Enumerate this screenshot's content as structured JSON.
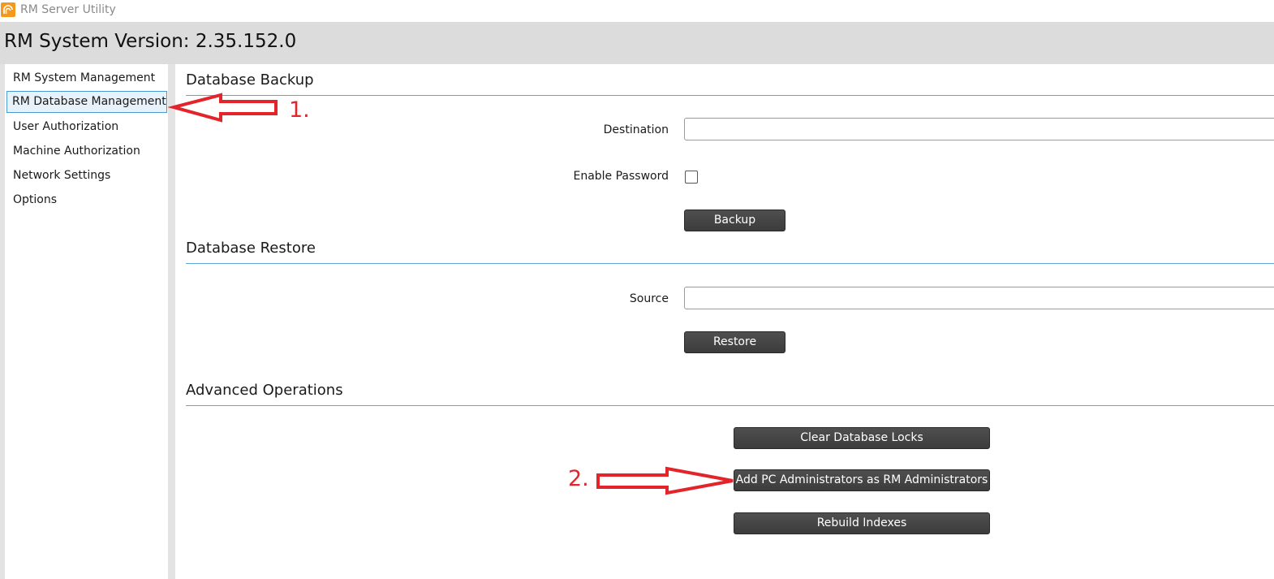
{
  "window": {
    "title": "RM Server Utility",
    "icon": "app-logo-icon"
  },
  "header": {
    "version": "RM System Version: 2.35.152.0"
  },
  "sidebar": {
    "items": [
      {
        "label": "RM System Management",
        "selected": false
      },
      {
        "label": "RM Database Management",
        "selected": true
      },
      {
        "label": "User Authorization",
        "selected": false
      },
      {
        "label": "Machine Authorization",
        "selected": false
      },
      {
        "label": "Network Settings",
        "selected": false
      },
      {
        "label": "Options",
        "selected": false
      }
    ]
  },
  "backup": {
    "title": "Database Backup",
    "destination_label": "Destination",
    "destination_value": "",
    "enable_password_label": "Enable Password",
    "enable_password_checked": false,
    "backup_button": "Backup"
  },
  "restore": {
    "title": "Database Restore",
    "source_label": "Source",
    "source_value": "",
    "restore_button": "Restore"
  },
  "advanced": {
    "title": "Advanced Operations",
    "clear_locks_button": "Clear Database Locks",
    "add_admins_button": "Add PC Administrators as RM Administrators",
    "rebuild_indexes_button": "Rebuild Indexes"
  },
  "annotations": {
    "step1": "1.",
    "step2": "2.",
    "color": "#e3242b"
  }
}
